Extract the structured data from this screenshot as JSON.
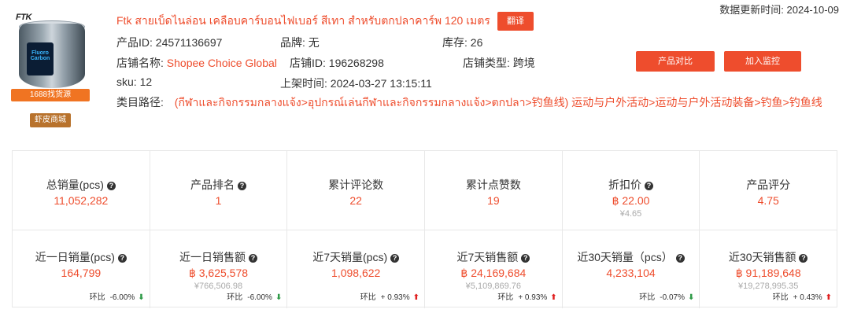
{
  "updated": {
    "label": "数据更新时间:",
    "value": "2024-10-09"
  },
  "product": {
    "image": {
      "brand_text": "FTK",
      "label_text": "Fluoro Carbon"
    },
    "source_badge": "1688找货源",
    "mall_badge": "虾皮商城",
    "title": "Ftk สายเบ็ดไนล่อน เคลือบคาร์บอนไฟเบอร์ สีเทา สำหรับตกปลาคาร์พ 120 เมตร",
    "translate_label": "翻译",
    "fields": {
      "product_id": {
        "label": "产品ID:",
        "value": "24571136697"
      },
      "brand": {
        "label": "品牌:",
        "value": "无"
      },
      "stock": {
        "label": "库存:",
        "value": "26"
      },
      "shop_name": {
        "label": "店铺名称:",
        "value": "Shopee Choice Global"
      },
      "shop_id": {
        "label": "店铺ID:",
        "value": "196268298"
      },
      "shop_type": {
        "label": "店铺类型:",
        "value": "跨境"
      },
      "sku": {
        "label": "sku:",
        "value": "12"
      },
      "listed": {
        "label": "上架时间:",
        "value": "2024-03-27 13:15:11"
      }
    },
    "category": {
      "label": "类目路径:",
      "path": "(กีฬาและกิจกรรมกลางแจ้ง>อุปกรณ์เล่นกีฬาและกิจกรรมกลางแจ้ง>ตกปลา>钓鱼线) 运动与户外活动>运动与户外活动装备>钓鱼>钓鱼线"
    },
    "buttons": {
      "compare": "产品对比",
      "monitor": "加入监控"
    }
  },
  "stats_row1": [
    {
      "label": "总销量(pcs)",
      "help": true,
      "value": "11,052,282"
    },
    {
      "label": "产品排名",
      "help": true,
      "value": "1"
    },
    {
      "label": "累计评论数",
      "help": false,
      "value": "22"
    },
    {
      "label": "累计点赞数",
      "help": false,
      "value": "19"
    },
    {
      "label": "折扣价",
      "help": true,
      "value": "฿ 22.00",
      "sub": "¥4.65"
    },
    {
      "label": "产品评分",
      "help": false,
      "value": "4.75"
    }
  ],
  "stats_row2": [
    {
      "label": "近一日销量(pcs)",
      "value": "164,799",
      "trend_label": "环比",
      "trend": "-6.00%",
      "dir": "down"
    },
    {
      "label": "近一日销售额",
      "value": "฿ 3,625,578",
      "sub": "¥766,506.98",
      "trend_label": "环比",
      "trend": "-6.00%",
      "dir": "down"
    },
    {
      "label": "近7天销量(pcs)",
      "value": "1,098,622",
      "trend_label": "环比",
      "trend": "+ 0.93%",
      "dir": "up"
    },
    {
      "label": "近7天销售额",
      "value": "฿ 24,169,684",
      "sub": "¥5,109,869.76",
      "trend_label": "环比",
      "trend": "+ 0.93%",
      "dir": "up"
    },
    {
      "label": "近30天销量（pcs）",
      "value": "4,233,104",
      "trend_label": "环比",
      "trend": "-0.07%",
      "dir": "down"
    },
    {
      "label": "近30天销售额",
      "value": "฿ 91,189,648",
      "sub": "¥19,278,995.35",
      "trend_label": "环比",
      "trend": "+ 0.43%",
      "dir": "up"
    }
  ],
  "icons": {
    "help": "question-circle-icon",
    "up": "arrow-up-icon",
    "down": "arrow-down-icon"
  },
  "colors": {
    "accent": "#ee4d2d",
    "source_badge": "#f07422",
    "mall_badge": "#b8722c",
    "up": "#e02020",
    "down": "#2e9a47"
  }
}
